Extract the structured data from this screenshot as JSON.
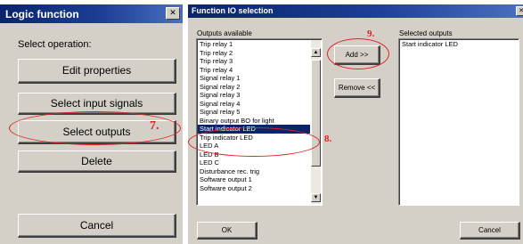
{
  "logic_window": {
    "title": "Logic function",
    "close_glyph": "✕",
    "prompt": "Select operation:",
    "buttons": {
      "edit_properties": "Edit properties",
      "select_input_signals": "Select input signals",
      "select_outputs": "Select outputs",
      "delete": "Delete",
      "cancel": "Cancel"
    },
    "annotation_number": "7."
  },
  "io_window": {
    "title": "Function IO selection",
    "close_glyph": "✕",
    "outputs_available_label": "Outputs available",
    "selected_outputs_label": "Selected outputs",
    "outputs_available": [
      "Trip relay 1",
      "Trip relay 2",
      "Trip relay 3",
      "Trip relay 4",
      "Signal relay 1",
      "Signal relay 2",
      "Signal relay 3",
      "Signal relay 4",
      "Signal relay 5",
      "Binary output BO for light",
      "Start indicator LED",
      "Trip indicator LED",
      "LED A",
      "LED B",
      "LED C",
      "Disturbance rec. trig",
      "Software output 1",
      "Software output 2"
    ],
    "selected_index": 10,
    "selected_outputs": [
      "Start indicator LED"
    ],
    "buttons": {
      "add": "Add >>",
      "remove": "Remove <<",
      "ok": "OK",
      "cancel": "Cancel"
    },
    "annotation_numbers": {
      "add": "9.",
      "list": "8."
    },
    "scroll_up_glyph": "▲",
    "scroll_down_glyph": "▼"
  },
  "colors": {
    "titlebar": "#0a246a",
    "window_face": "#d4d0c8",
    "selection": "#0a246a",
    "annotation": "#e02020"
  }
}
